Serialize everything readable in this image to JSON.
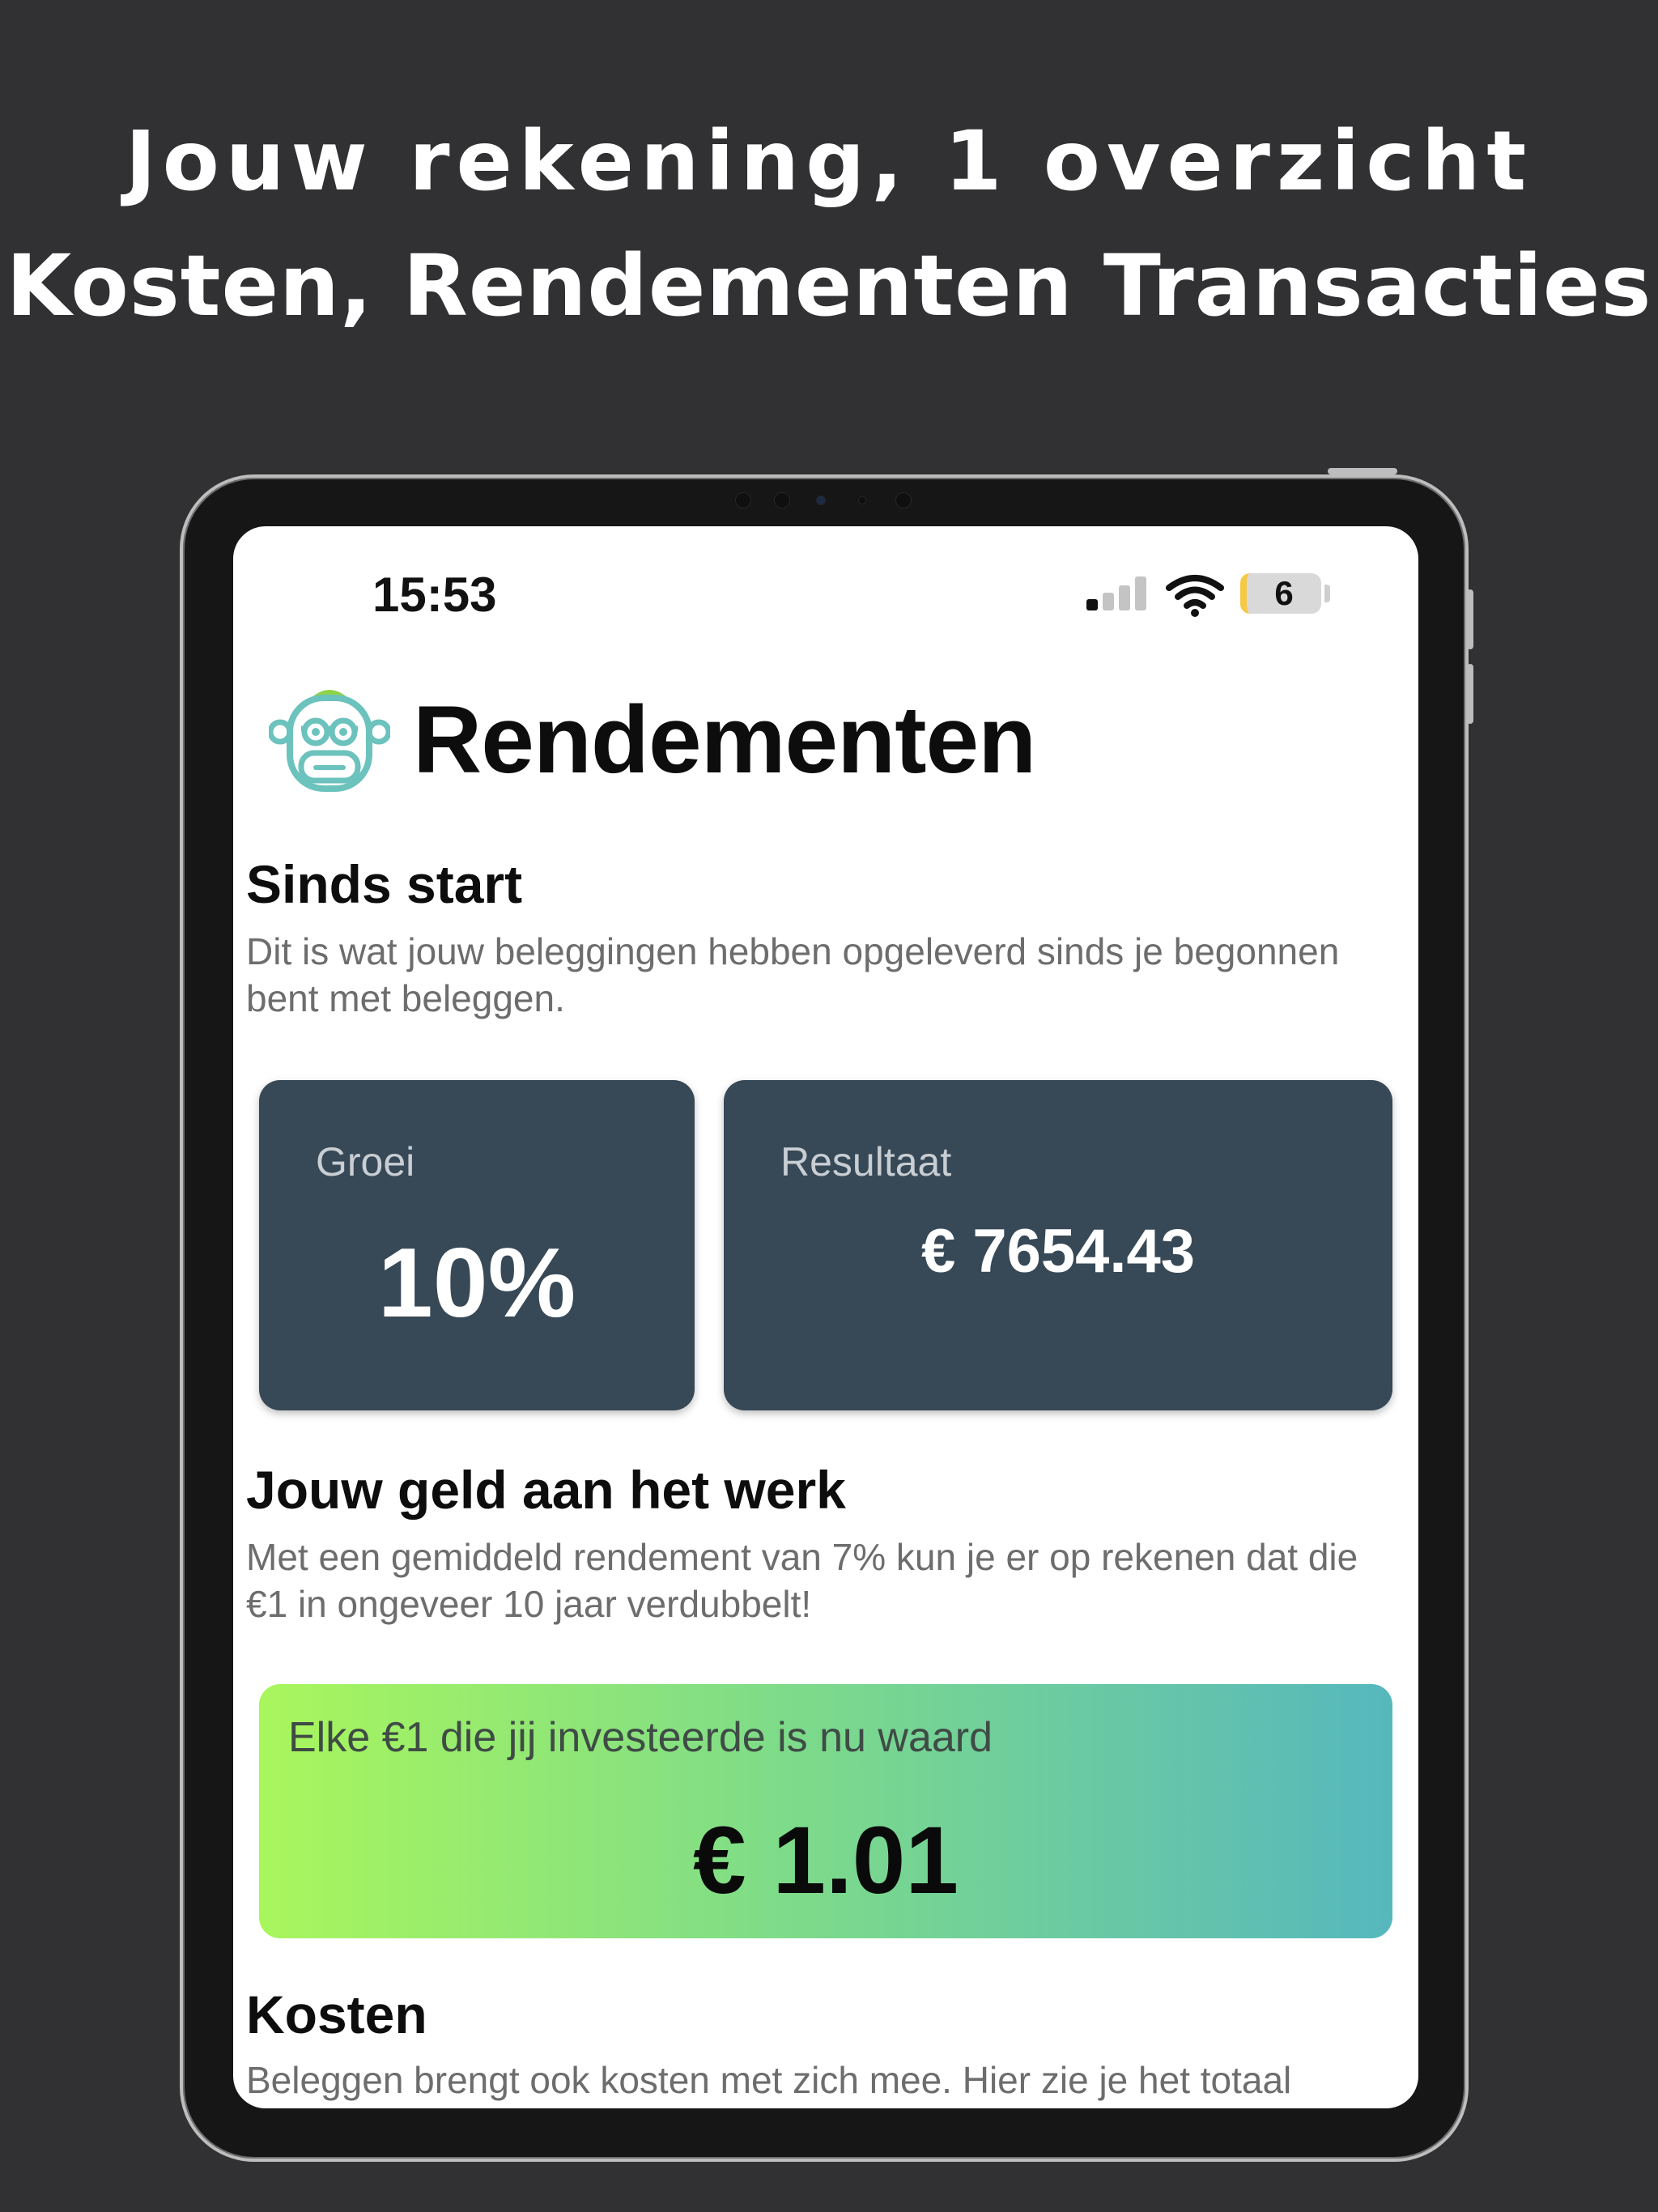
{
  "promo": {
    "headline_line1": "Jouw rekening, 1 overzicht",
    "headline_line2": "Kosten, Rendementen Transacties"
  },
  "status_bar": {
    "time": "15:53",
    "battery_level": "6",
    "signal_icon": "cellular-signal-icon",
    "wifi_icon": "wifi-icon",
    "battery_icon": "battery-icon"
  },
  "header": {
    "logo_icon": "monkey-logo-icon",
    "title": "Rendementen"
  },
  "since_start": {
    "title": "Sinds start",
    "description": "Dit is wat jouw beleggingen hebben opgeleverd sinds je begonnen bent met beleggen."
  },
  "cards": {
    "growth_label": "Groei",
    "growth_value": "10%",
    "result_label": "Resultaat",
    "result_value": "€ 7654.43"
  },
  "money_at_work": {
    "title": "Jouw geld aan het werk",
    "description": "Met een gemiddeld rendement van 7% kun je er op rekenen dat die €1 in ongeveer 10 jaar verdubbelt!",
    "card_label": "Elke €1 die jij investeerde is nu waard",
    "card_value": "€ 1.01"
  },
  "costs": {
    "title": "Kosten",
    "description": "Beleggen brengt ook kosten met zich mee. Hier zie je het totaal"
  },
  "colors": {
    "background": "#313133",
    "card_dark": "#374856",
    "gradient_start": "#a9f65c",
    "gradient_end": "#56b8bd",
    "battery_accent": "#f6c945"
  }
}
